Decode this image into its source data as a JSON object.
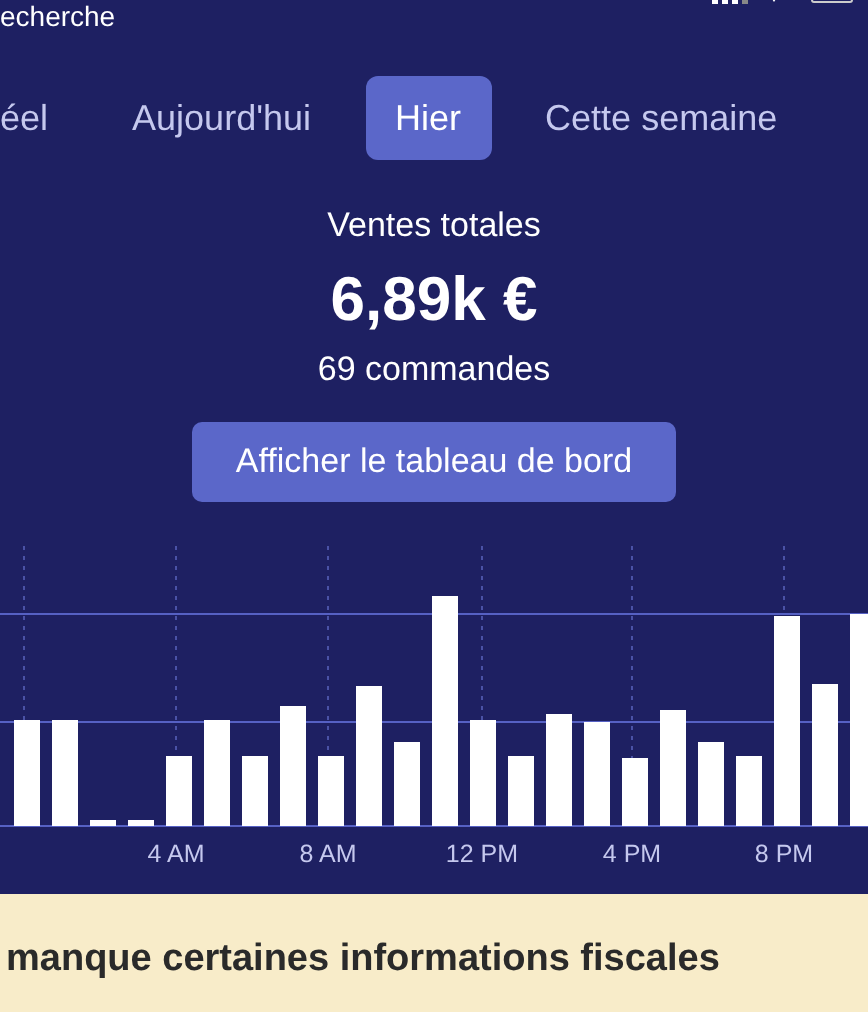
{
  "status_bar": {
    "back_label": "echerche"
  },
  "tabs": [
    {
      "label": "éel",
      "selected": false
    },
    {
      "label": "Aujourd'hui",
      "selected": false
    },
    {
      "label": "Hier",
      "selected": true
    },
    {
      "label": "Cette semaine",
      "selected": false
    }
  ],
  "summary": {
    "title": "Ventes totales",
    "amount": "6,89k €",
    "orders": "69 commandes"
  },
  "dashboard_button": "Afficher le tableau de bord",
  "chart": {
    "x_labels": [
      "4 AM",
      "8 AM",
      "12 PM",
      "4 PM",
      "8 PM"
    ]
  },
  "banner": {
    "lines": [
      "manque certaines informations fiscales"
    ]
  }
}
